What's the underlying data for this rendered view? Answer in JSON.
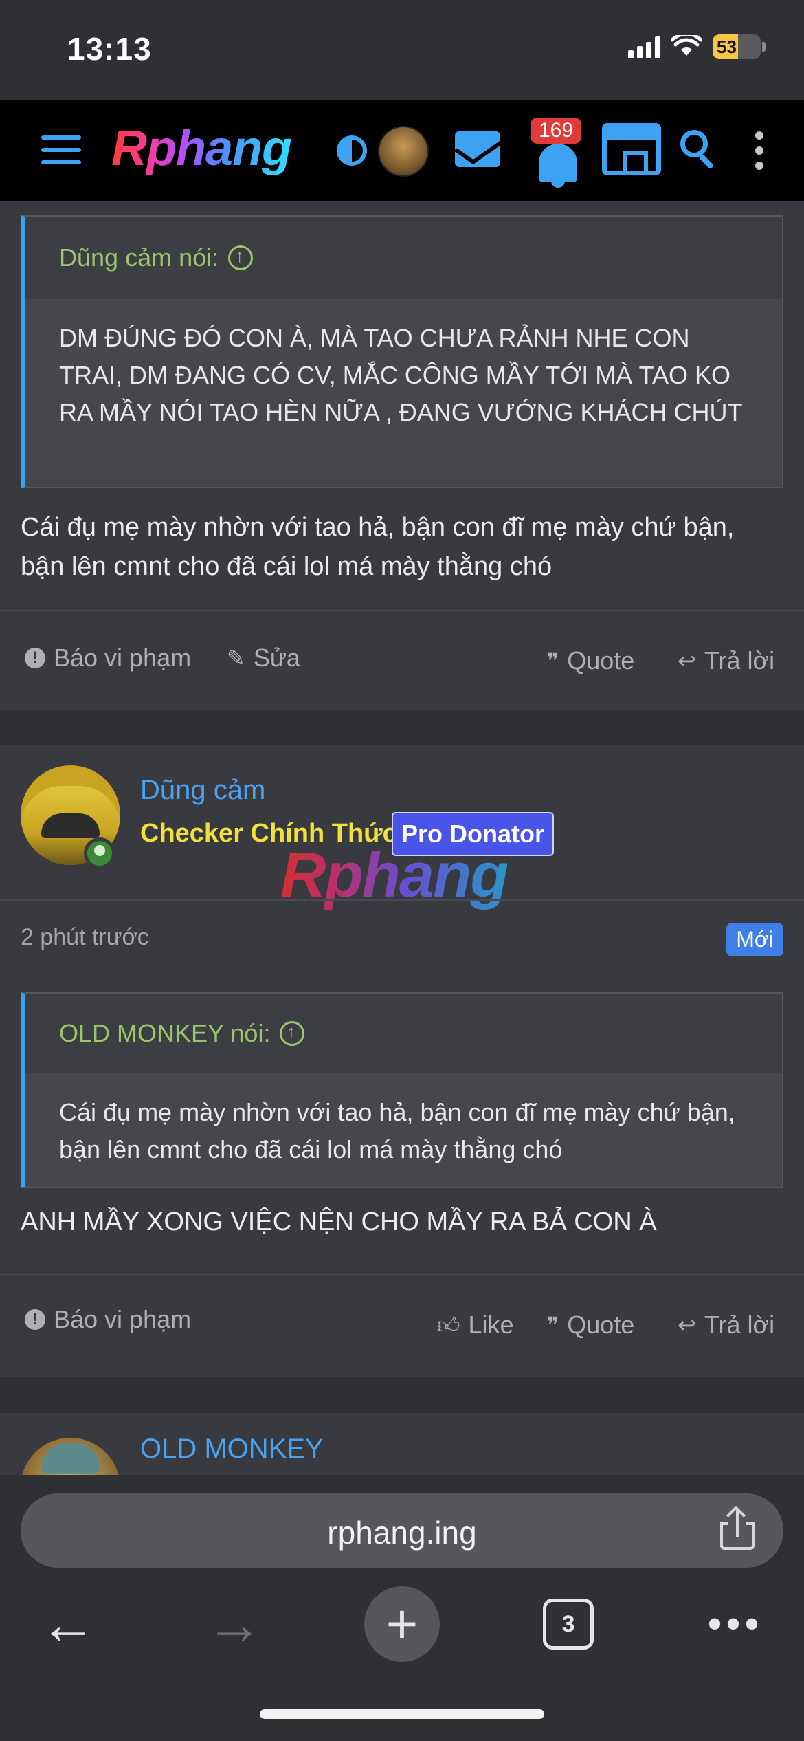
{
  "status_bar": {
    "time": "13:13",
    "battery": "53"
  },
  "nav": {
    "logo": "Rphang",
    "notification_count": "169"
  },
  "thread": {
    "post1": {
      "quote_author": "Dũng cảm nói:",
      "quote_text": "DM ĐÚNG ĐÓ CON À, MÀ TAO CHƯA RẢNH NHE CON TRAI, DM ĐANG CÓ CV, MẮC CÔNG MẦY TỚI MÀ TAO KO RA MẦY NÓI TAO HÈN NỮA , ĐANG VƯỚNG KHÁCH CHÚT",
      "message": "Cái đụ mẹ mày nhờn với tao hả, bận con đĩ mẹ mày chứ bận, bận lên cmnt cho đã cái lol má mày thằng chó",
      "actions": {
        "report": "Báo vi phạm",
        "edit": "Sửa",
        "quote": "Quote",
        "reply": "Trả lời"
      }
    },
    "post2": {
      "author_name": "Dũng cảm",
      "author_title": "Checker Chính Thức",
      "author_badge": "Pro Donator",
      "watermark": "Rphang",
      "time": "2 phút trước",
      "new_label": "Mới",
      "quote_author": "OLD MONKEY nói:",
      "quote_text": "Cái đụ mẹ mày nhờn với tao hả, bận con đĩ mẹ mày chứ bận, bận lên cmnt cho đã cái lol má mày thằng chó",
      "message": "ANH MẦY XONG VIỆC NỆN CHO MẦY RA BẢ CON À",
      "actions": {
        "report": "Báo vi phạm",
        "like": "Like",
        "quote": "Quote",
        "reply": "Trả lời"
      }
    },
    "post3": {
      "author_name": "OLD MONKEY"
    }
  },
  "browser": {
    "url": "rphang.ing",
    "tab_count": "3"
  },
  "colors": {
    "accent": "#3ea2f2",
    "quote_author": "#9cc46a",
    "title_yellow": "#f2e03c",
    "badge_blue": "#4a54e8",
    "notification_red": "#e03a3a"
  }
}
